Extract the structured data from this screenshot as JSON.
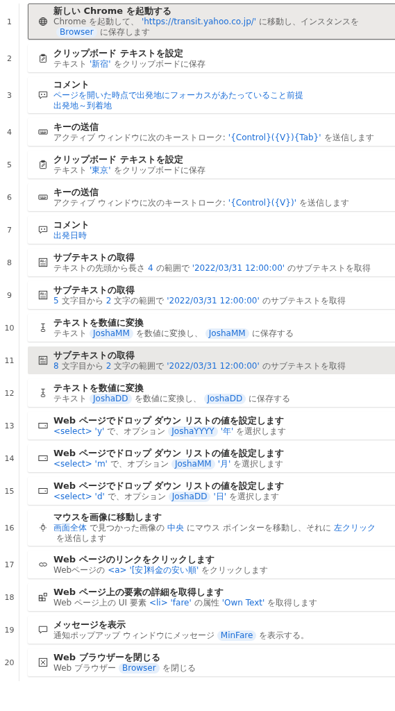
{
  "steps": [
    {
      "number": "1",
      "kind": "launch",
      "selected": true,
      "hovered": false,
      "title": "新しい Chrome を起動する",
      "lines": [
        [
          {
            "text": "Chrome を起動して、",
            "kind": "plain"
          },
          {
            "text": "'https://transit.yahoo.co.jp/'",
            "kind": "value"
          },
          {
            "text": "に移動し、インスタンスを",
            "kind": "plain"
          },
          {
            "text": "Browser",
            "kind": "variable"
          },
          {
            "text": "に保存します",
            "kind": "plain"
          }
        ]
      ]
    },
    {
      "number": "2",
      "kind": "clipboard",
      "selected": false,
      "hovered": false,
      "title": "クリップボード テキストを設定",
      "lines": [
        [
          {
            "text": "テキスト",
            "kind": "plain"
          },
          {
            "text": "'新宿'",
            "kind": "value"
          },
          {
            "text": "をクリップボードに保存",
            "kind": "plain"
          }
        ]
      ]
    },
    {
      "number": "3",
      "kind": "comment",
      "selected": false,
      "hovered": false,
      "title": "コメント",
      "lines": [
        [
          {
            "text": "ページを開いた時点で出発地にフォーカスがあたっていること前提",
            "kind": "value"
          }
        ],
        [
          {
            "text": "出発地～到着地",
            "kind": "value"
          }
        ]
      ]
    },
    {
      "number": "4",
      "kind": "keys",
      "selected": false,
      "hovered": false,
      "title": "キーの送信",
      "lines": [
        [
          {
            "text": "アクティブ ウィンドウに次のキーストローク:",
            "kind": "plain"
          },
          {
            "text": "'{Control}({V}){Tab}'",
            "kind": "value"
          },
          {
            "text": "を送信します",
            "kind": "plain"
          }
        ]
      ]
    },
    {
      "number": "5",
      "kind": "clipboard",
      "selected": false,
      "hovered": false,
      "title": "クリップボード テキストを設定",
      "lines": [
        [
          {
            "text": "テキスト",
            "kind": "plain"
          },
          {
            "text": "'東京'",
            "kind": "value"
          },
          {
            "text": "をクリップボードに保存",
            "kind": "plain"
          }
        ]
      ]
    },
    {
      "number": "6",
      "kind": "keys",
      "selected": false,
      "hovered": false,
      "title": "キーの送信",
      "lines": [
        [
          {
            "text": "アクティブ ウィンドウに次のキーストローク:",
            "kind": "plain"
          },
          {
            "text": "'{Control}({V})'",
            "kind": "value"
          },
          {
            "text": "を送信します",
            "kind": "plain"
          }
        ]
      ]
    },
    {
      "number": "7",
      "kind": "comment",
      "selected": false,
      "hovered": false,
      "title": "コメント",
      "lines": [
        [
          {
            "text": "出発日時",
            "kind": "value"
          }
        ]
      ]
    },
    {
      "number": "8",
      "kind": "subtext",
      "selected": false,
      "hovered": false,
      "title": "サブテキストの取得",
      "lines": [
        [
          {
            "text": "テキストの先頭から長さ",
            "kind": "plain"
          },
          {
            "text": "4",
            "kind": "value"
          },
          {
            "text": "の範囲で",
            "kind": "plain"
          },
          {
            "text": "'2022/03/31 12:00:00'",
            "kind": "value"
          },
          {
            "text": "のサブテキストを取得",
            "kind": "plain"
          }
        ]
      ]
    },
    {
      "number": "9",
      "kind": "subtext",
      "selected": false,
      "hovered": false,
      "title": "サブテキストの取得",
      "lines": [
        [
          {
            "text": "5",
            "kind": "value"
          },
          {
            "text": "文字目から",
            "kind": "plain"
          },
          {
            "text": "2",
            "kind": "value"
          },
          {
            "text": "文字の範囲で",
            "kind": "plain"
          },
          {
            "text": "'2022/03/31 12:00:00'",
            "kind": "value"
          },
          {
            "text": "のサブテキストを取得",
            "kind": "plain"
          }
        ]
      ]
    },
    {
      "number": "10",
      "kind": "convert",
      "selected": false,
      "hovered": false,
      "title": "テキストを数値に変換",
      "lines": [
        [
          {
            "text": "テキスト",
            "kind": "plain"
          },
          {
            "text": "JoshaMM",
            "kind": "variable"
          },
          {
            "text": "を数値に変換し、",
            "kind": "plain"
          },
          {
            "text": "JoshaMM",
            "kind": "variable"
          },
          {
            "text": "に保存する",
            "kind": "plain"
          }
        ]
      ]
    },
    {
      "number": "11",
      "kind": "subtext",
      "selected": false,
      "hovered": true,
      "title": "サブテキストの取得",
      "lines": [
        [
          {
            "text": "8",
            "kind": "value"
          },
          {
            "text": "文字目から",
            "kind": "plain"
          },
          {
            "text": "2",
            "kind": "value"
          },
          {
            "text": "文字の範囲で",
            "kind": "plain"
          },
          {
            "text": "'2022/03/31 12:00:00'",
            "kind": "value"
          },
          {
            "text": "のサブテキストを取得",
            "kind": "plain"
          }
        ]
      ]
    },
    {
      "number": "12",
      "kind": "convert",
      "selected": false,
      "hovered": false,
      "title": "テキストを数値に変換",
      "lines": [
        [
          {
            "text": "テキスト",
            "kind": "plain"
          },
          {
            "text": "JoshaDD",
            "kind": "variable"
          },
          {
            "text": "を数値に変換し、",
            "kind": "plain"
          },
          {
            "text": "JoshaDD",
            "kind": "variable"
          },
          {
            "text": "に保存する",
            "kind": "plain"
          }
        ]
      ]
    },
    {
      "number": "13",
      "kind": "dropdown",
      "selected": false,
      "hovered": false,
      "title": "Web ページでドロップ ダウン リストの値を設定します",
      "lines": [
        [
          {
            "text": "<select> 'y'",
            "kind": "value"
          },
          {
            "text": "で、オプション",
            "kind": "plain"
          },
          {
            "text": "JoshaYYYY",
            "kind": "variable"
          },
          {
            "text": "'年'",
            "kind": "value"
          },
          {
            "text": "を選択します",
            "kind": "plain"
          }
        ]
      ]
    },
    {
      "number": "14",
      "kind": "dropdown",
      "selected": false,
      "hovered": false,
      "title": "Web ページでドロップ ダウン リストの値を設定します",
      "lines": [
        [
          {
            "text": "<select> 'm'",
            "kind": "value"
          },
          {
            "text": "で、オプション",
            "kind": "plain"
          },
          {
            "text": "JoshaMM",
            "kind": "variable"
          },
          {
            "text": "'月'",
            "kind": "value"
          },
          {
            "text": "を選択します",
            "kind": "plain"
          }
        ]
      ]
    },
    {
      "number": "15",
      "kind": "dropdown",
      "selected": false,
      "hovered": false,
      "title": "Web ページでドロップ ダウン リストの値を設定します",
      "lines": [
        [
          {
            "text": "<select> 'd'",
            "kind": "value"
          },
          {
            "text": "で、オプション",
            "kind": "plain"
          },
          {
            "text": "JoshaDD",
            "kind": "variable"
          },
          {
            "text": "'日'",
            "kind": "value"
          },
          {
            "text": "を選択します",
            "kind": "plain"
          }
        ]
      ]
    },
    {
      "number": "16",
      "kind": "mouse",
      "selected": false,
      "hovered": false,
      "title": "マウスを画像に移動します",
      "lines": [
        [
          {
            "text": "画面全体",
            "kind": "value"
          },
          {
            "text": "で見つかった画像の",
            "kind": "plain"
          },
          {
            "text": "中央",
            "kind": "value"
          },
          {
            "text": "にマウス ポインターを移動し、それに",
            "kind": "plain"
          },
          {
            "text": "左クリック",
            "kind": "value"
          },
          {
            "text": "を送信します",
            "kind": "plain"
          }
        ]
      ]
    },
    {
      "number": "17",
      "kind": "link",
      "selected": false,
      "hovered": false,
      "title": "Web ページのリンクをクリックします",
      "lines": [
        [
          {
            "text": "Webページの",
            "kind": "plain"
          },
          {
            "text": "<a> '[安]料金の安い順'",
            "kind": "value"
          },
          {
            "text": "をクリックします",
            "kind": "plain"
          }
        ]
      ]
    },
    {
      "number": "18",
      "kind": "element",
      "selected": false,
      "hovered": false,
      "title": "Web ページ上の要素の詳細を取得します",
      "lines": [
        [
          {
            "text": "Web ページ上の UI 要素",
            "kind": "plain"
          },
          {
            "text": "<li> 'fare'",
            "kind": "value"
          },
          {
            "text": "の属性",
            "kind": "plain"
          },
          {
            "text": "'Own Text'",
            "kind": "value"
          },
          {
            "text": "を取得します",
            "kind": "plain"
          }
        ]
      ]
    },
    {
      "number": "19",
      "kind": "message",
      "selected": false,
      "hovered": false,
      "title": "メッセージを表示",
      "lines": [
        [
          {
            "text": "通知ポップアップ ウィンドウにメッセージ",
            "kind": "plain"
          },
          {
            "text": "MinFare",
            "kind": "variable"
          },
          {
            "text": "を表示する。",
            "kind": "plain"
          }
        ]
      ]
    },
    {
      "number": "20",
      "kind": "close",
      "selected": false,
      "hovered": false,
      "title": "Web ブラウザーを閉じる",
      "lines": [
        [
          {
            "text": "Web ブラウザー",
            "kind": "plain"
          },
          {
            "text": "Browser",
            "kind": "variable"
          },
          {
            "text": "を閉じる",
            "kind": "plain"
          }
        ]
      ]
    }
  ]
}
